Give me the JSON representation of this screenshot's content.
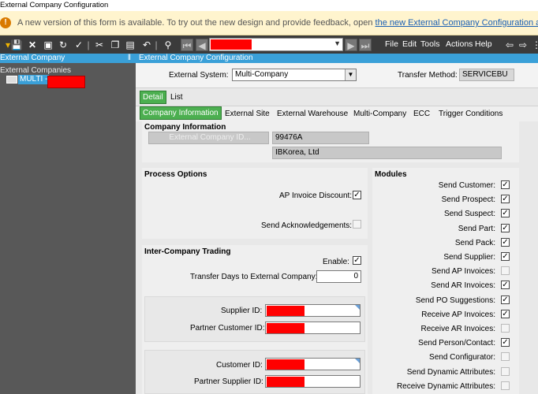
{
  "window": {
    "title": "External Company Configuration"
  },
  "banner": {
    "text": "A new version of this form is available. To try out the new design and provide feedback, open ",
    "link": "the new External Company Configuration app",
    "end": "."
  },
  "toolbar": {
    "menus": [
      "File",
      "Edit",
      "Tools",
      "Actions",
      "Help"
    ]
  },
  "left": {
    "title": "External Company",
    "pin": "‖",
    "tree_root": "External Companies",
    "tree_item": "MULTI -"
  },
  "right": {
    "title": "External Company Configuration",
    "external_system_label": "External System:",
    "external_system_value": "Multi-Company",
    "transfer_method_label": "Transfer Method:",
    "transfer_method_value": "SERVICEBU",
    "view_tabs": [
      "Detail",
      "List"
    ],
    "tabs": [
      "Company Information",
      "External Site",
      "External Warehouse",
      "Multi-Company",
      "ECC",
      "Trigger Conditions"
    ],
    "company_info": {
      "title": "Company Information",
      "id_placeholder": "External Company ID...",
      "id_value": "99476A",
      "name_value": "IBKorea, Ltd"
    },
    "process_options": {
      "title": "Process Options",
      "ap_invoice_discount": "AP Invoice Discount:",
      "send_acknowledgements": "Send Acknowledgements:"
    },
    "intercompany": {
      "title": "Inter-Company Trading",
      "enable": "Enable:",
      "transfer_days_label": "Transfer Days to External Company:",
      "transfer_days_value": "0",
      "supplier_id": "Supplier ID:",
      "partner_customer_id": "Partner Customer ID:",
      "customer_id": "Customer ID:",
      "partner_supplier_id": "Partner Supplier ID:"
    },
    "modules": {
      "title": "Modules",
      "items": [
        {
          "label": "Send Customer:",
          "checked": true
        },
        {
          "label": "Send Prospect:",
          "checked": true
        },
        {
          "label": "Send Suspect:",
          "checked": true
        },
        {
          "label": "Send Part:",
          "checked": true
        },
        {
          "label": "Send Pack:",
          "checked": true
        },
        {
          "label": "Send Supplier:",
          "checked": true
        },
        {
          "label": "Send AP Invoices:",
          "checked": false
        },
        {
          "label": "Send AR Invoices:",
          "checked": true
        },
        {
          "label": "Send PO Suggestions:",
          "checked": true
        },
        {
          "label": "Receive AP Invoices:",
          "checked": true
        },
        {
          "label": "Receive AR Invoices:",
          "checked": false
        },
        {
          "label": "Send Person/Contact:",
          "checked": true
        },
        {
          "label": "Send Configurator:",
          "checked": false
        },
        {
          "label": "Send Dynamic Attributes:",
          "checked": false
        },
        {
          "label": "Receive Dynamic Attributes:",
          "checked": false
        }
      ]
    }
  },
  "colors": {
    "accent": "#3aa0d8",
    "active_tab": "#4caf50",
    "redaction": "#ff0000",
    "banner_bg": "#fff4ce"
  }
}
